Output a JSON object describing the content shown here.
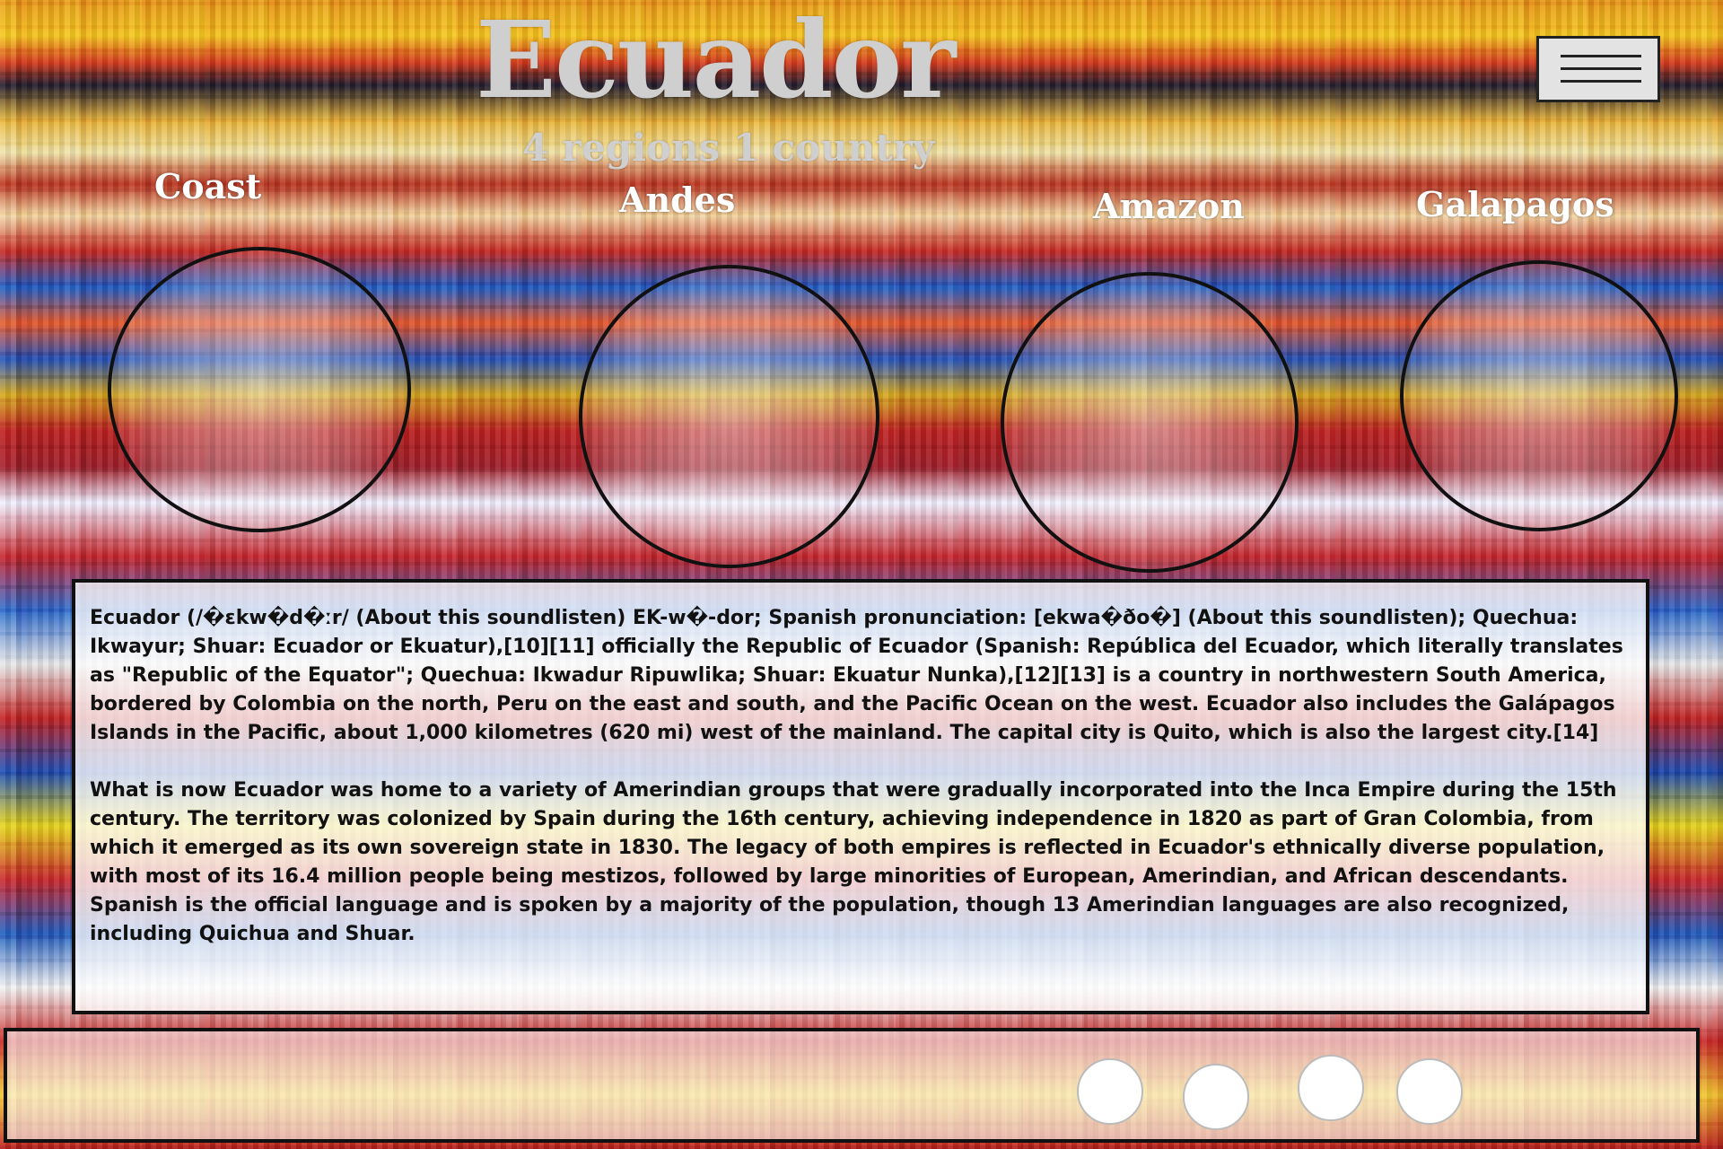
{
  "header": {
    "title": "Ecuador",
    "subtitle": "4 regions 1 country",
    "menu_icon": "hamburger-menu-icon"
  },
  "regions": [
    {
      "label": "Coast"
    },
    {
      "label": "Andes"
    },
    {
      "label": "Amazon"
    },
    {
      "label": "Galapagos"
    }
  ],
  "info": {
    "paragraphs": [
      "Ecuador (/�ɛkw�d�ːr/ (About this soundlisten) EK-w�-dor; Spanish pronunciation: [ekwa�ðo�] (About this soundlisten); Quechua: Ikwayur; Shuar: Ecuador or Ekuatur),[10][11] officially the Republic of Ecuador (Spanish: República del Ecuador, which literally translates as \"Republic of the Equator\"; Quechua: Ikwadur Ripuwlika; Shuar: Ekuatur Nunka),[12][13] is a country in northwestern South America, bordered by Colombia on the north, Peru on the east and south, and the Pacific Ocean on the west. Ecuador also includes the Galápagos Islands in the Pacific, about 1,000 kilometres (620 mi) west of the mainland. The capital city is Quito, which is also the largest city.[14]",
      "What is now Ecuador was home to a variety of Amerindian groups that were gradually incorporated into the Inca Empire during the 15th century. The territory was colonized by Spain during the 16th century, achieving independence in 1820 as part of Gran Colombia, from which it emerged as its own sovereign state in 1830. The legacy of both empires is reflected in Ecuador's ethnically diverse population, with most of its 16.4 million people being mestizos, followed by large minorities of European, Amerindian, and African descendants. Spanish is the official language and is spoken by a majority of the population, though 13 Amerindian languages are also recognized, including Quichua and Shuar."
    ]
  },
  "colors": {
    "title_color": "#cfcfcf",
    "panel_border": "#111111",
    "region_label_color": "#ffffff"
  }
}
